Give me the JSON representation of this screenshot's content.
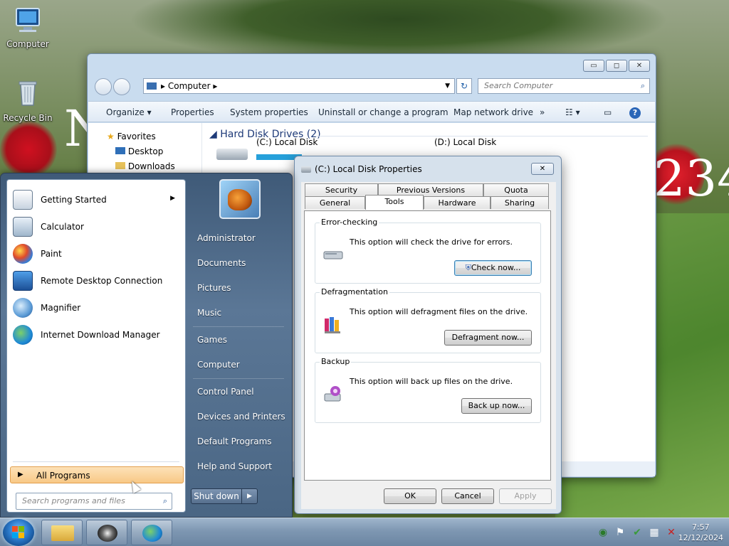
{
  "desktop": {
    "icons": [
      {
        "label": "Computer",
        "icon": "computer-icon"
      },
      {
        "label": "Recycle Bin",
        "icon": "recycle-bin-icon"
      }
    ]
  },
  "explorer": {
    "address": "Computer",
    "search_placeholder": "Search Computer",
    "toolbar": [
      "Organize",
      "Properties",
      "System properties",
      "Uninstall or change a program",
      "Map network drive"
    ],
    "more_label": "»",
    "nav": {
      "favorites": "Favorites",
      "items": [
        "Desktop",
        "Downloads"
      ]
    },
    "group_header": "Hard Disk Drives (2)",
    "drives": [
      "(C:) Local Disk",
      "(D:) Local Disk"
    ],
    "window_buttons": {
      "minimize": "▭",
      "maximize": "◻",
      "close": "✕"
    }
  },
  "dialog": {
    "title": "(C:) Local Disk Properties",
    "close_label": "✕",
    "tabs_row1": [
      "Security",
      "Previous Versions",
      "Quota"
    ],
    "tabs_row2": [
      "General",
      "Tools",
      "Hardware",
      "Sharing"
    ],
    "active_tab": "Tools",
    "sections": [
      {
        "title": "Error-checking",
        "text": "This option will check the drive for errors.",
        "button": "Check now..."
      },
      {
        "title": "Defragmentation",
        "text": "This option will defragment files on the drive.",
        "button": "Defragment now..."
      },
      {
        "title": "Backup",
        "text": "This option will back up files on the drive.",
        "button": "Back up now..."
      }
    ],
    "footer": {
      "ok": "OK",
      "cancel": "Cancel",
      "apply": "Apply"
    }
  },
  "start_menu": {
    "programs": [
      {
        "label": "Getting Started",
        "icon": "getting-started-icon",
        "has_submenu": true
      },
      {
        "label": "Calculator",
        "icon": "calculator-icon"
      },
      {
        "label": "Paint",
        "icon": "paint-icon"
      },
      {
        "label": "Remote Desktop Connection",
        "icon": "remote-desktop-icon"
      },
      {
        "label": "Magnifier",
        "icon": "magnifier-icon"
      },
      {
        "label": "Internet Download Manager",
        "icon": "idm-icon"
      }
    ],
    "all_programs": "All Programs",
    "search_placeholder": "Search programs and files",
    "right_items": [
      "Administrator",
      "Documents",
      "Pictures",
      "Music",
      "Games",
      "Computer",
      "Control Panel",
      "Devices and Printers",
      "Default Programs",
      "Help and Support"
    ],
    "shutdown_label": "Shut down",
    "shutdown_arrow": "▶"
  },
  "taskbar": {
    "clock_time": "7:57",
    "clock_date": "12/12/2024"
  },
  "colors": {
    "accent": "#1e3a78",
    "taskbar": "#7e97b2",
    "start_menu": "#4a6684",
    "highlight": "#f8c886"
  }
}
